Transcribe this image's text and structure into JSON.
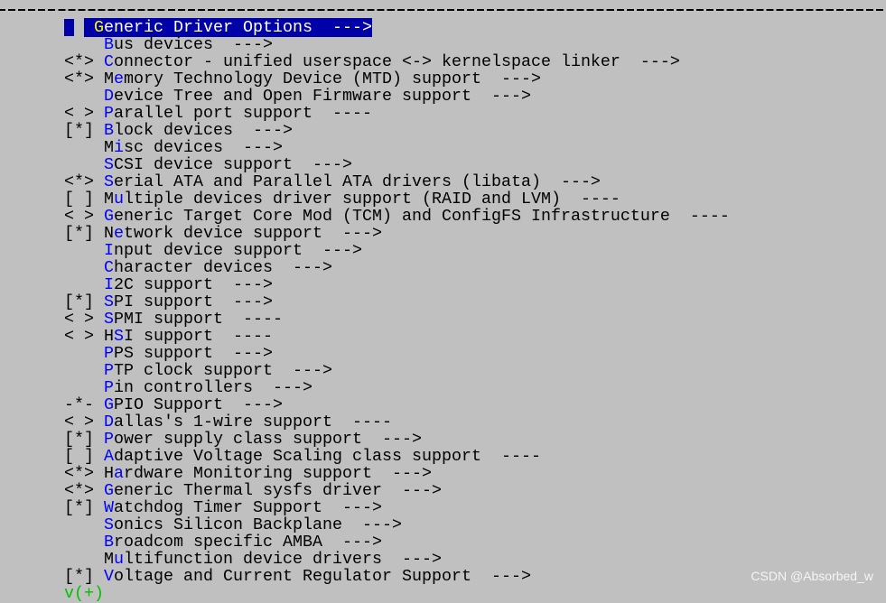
{
  "menu": {
    "selected_index": 0,
    "items": [
      {
        "prefix": "   ",
        "pre": "",
        "key": "G",
        "rest": "eneric Driver Options  --->"
      },
      {
        "prefix": "   ",
        "pre": "",
        "key": "B",
        "rest": "us devices  --->"
      },
      {
        "prefix": "<*>",
        "pre": "",
        "key": "C",
        "rest": "onnector - unified userspace <-> kernelspace linker  --->"
      },
      {
        "prefix": "<*>",
        "pre": "M",
        "key": "e",
        "rest": "mory Technology Device (MTD) support  --->"
      },
      {
        "prefix": "   ",
        "pre": "",
        "key": "D",
        "rest": "evice Tree and Open Firmware support  --->"
      },
      {
        "prefix": "< >",
        "pre": "",
        "key": "P",
        "rest": "arallel port support  ----"
      },
      {
        "prefix": "[*]",
        "pre": "",
        "key": "B",
        "rest": "lock devices  --->"
      },
      {
        "prefix": "   ",
        "pre": "M",
        "key": "i",
        "rest": "sc devices  --->"
      },
      {
        "prefix": "   ",
        "pre": "",
        "key": "S",
        "rest": "CSI device support  --->"
      },
      {
        "prefix": "<*>",
        "pre": "",
        "key": "S",
        "rest": "erial ATA and Parallel ATA drivers (libata)  --->"
      },
      {
        "prefix": "[ ]",
        "pre": "M",
        "key": "u",
        "rest": "ltiple devices driver support (RAID and LVM)  ----"
      },
      {
        "prefix": "< >",
        "pre": "",
        "key": "G",
        "rest": "eneric Target Core Mod (TCM) and ConfigFS Infrastructure  ----"
      },
      {
        "prefix": "[*]",
        "pre": "N",
        "key": "e",
        "rest": "twork device support  --->"
      },
      {
        "prefix": "   ",
        "pre": "",
        "key": "I",
        "rest": "nput device support  --->"
      },
      {
        "prefix": "   ",
        "pre": "",
        "key": "C",
        "rest": "haracter devices  --->"
      },
      {
        "prefix": "   ",
        "pre": "",
        "key": "I",
        "rest": "2C support  --->"
      },
      {
        "prefix": "[*]",
        "pre": "",
        "key": "S",
        "rest": "PI support  --->"
      },
      {
        "prefix": "< >",
        "pre": "",
        "key": "S",
        "rest": "PMI support  ----"
      },
      {
        "prefix": "< >",
        "pre": "H",
        "key": "S",
        "rest": "I support  ----"
      },
      {
        "prefix": "   ",
        "pre": "",
        "key": "P",
        "rest": "PS support  --->"
      },
      {
        "prefix": "   ",
        "pre": "",
        "key": "P",
        "rest": "TP clock support  --->"
      },
      {
        "prefix": "   ",
        "pre": "",
        "key": "P",
        "rest": "in controllers  --->"
      },
      {
        "prefix": "-*-",
        "pre": "",
        "key": "G",
        "rest": "PIO Support  --->"
      },
      {
        "prefix": "< >",
        "pre": "",
        "key": "D",
        "rest": "allas's 1-wire support  ----"
      },
      {
        "prefix": "[*]",
        "pre": "",
        "key": "P",
        "rest": "ower supply class support  --->"
      },
      {
        "prefix": "[ ]",
        "pre": "",
        "key": "A",
        "rest": "daptive Voltage Scaling class support  ----"
      },
      {
        "prefix": "<*>",
        "pre": "H",
        "key": "a",
        "rest": "rdware Monitoring support  --->"
      },
      {
        "prefix": "<*>",
        "pre": "",
        "key": "G",
        "rest": "eneric Thermal sysfs driver  --->"
      },
      {
        "prefix": "[*]",
        "pre": "",
        "key": "W",
        "rest": "atchdog Timer Support  --->"
      },
      {
        "prefix": "   ",
        "pre": "",
        "key": "S",
        "rest": "onics Silicon Backplane  --->"
      },
      {
        "prefix": "   ",
        "pre": "",
        "key": "B",
        "rest": "roadcom specific AMBA  --->"
      },
      {
        "prefix": "   ",
        "pre": "M",
        "key": "u",
        "rest": "ltifunction device drivers  --->"
      },
      {
        "prefix": "[*]",
        "pre": "",
        "key": "V",
        "rest": "oltage and Current Regulator Support  --->"
      }
    ],
    "more_indicator": "v(+)"
  },
  "colors": {
    "background": "#c0c0c0",
    "highlight": "#0000a8",
    "hotkey": "#0000ff",
    "selected_hotkey": "#ffff00",
    "more": "#00c000"
  },
  "watermark": "CSDN @Absorbed_w"
}
